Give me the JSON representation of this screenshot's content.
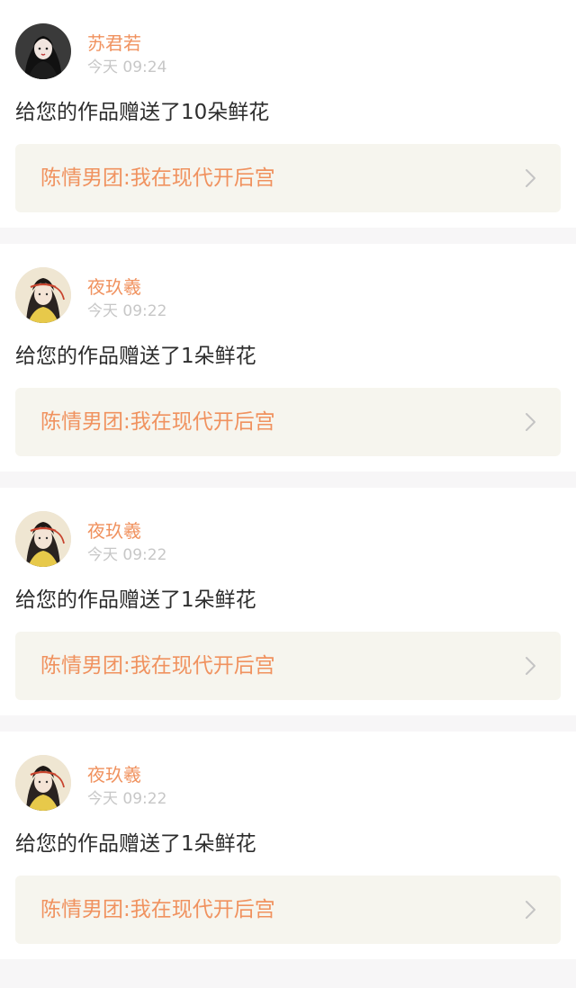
{
  "notifications": [
    {
      "username": "苏君若",
      "time": "今天 09:24",
      "message": "给您的作品赠送了10朵鲜花",
      "work_title": "陈情男团:我在现代开后宫",
      "avatar": "avatar-dark-hair-girl"
    },
    {
      "username": "夜玖羲",
      "time": "今天 09:22",
      "message": "给您的作品赠送了1朵鲜花",
      "work_title": "陈情男团:我在现代开后宫",
      "avatar": "avatar-ancient-costume-boy"
    },
    {
      "username": "夜玖羲",
      "time": "今天 09:22",
      "message": "给您的作品赠送了1朵鲜花",
      "work_title": "陈情男团:我在现代开后宫",
      "avatar": "avatar-ancient-costume-boy"
    },
    {
      "username": "夜玖羲",
      "time": "今天 09:22",
      "message": "给您的作品赠送了1朵鲜花",
      "work_title": "陈情男团:我在现代开后宫",
      "avatar": "avatar-ancient-costume-boy"
    }
  ],
  "icons": {
    "chevron": "chevron-right-icon"
  },
  "colors": {
    "accent": "#f0925f",
    "timestamp": "#c7c7c7",
    "work_bg": "#f6f5ee",
    "page_bg": "#f7f6f7"
  }
}
